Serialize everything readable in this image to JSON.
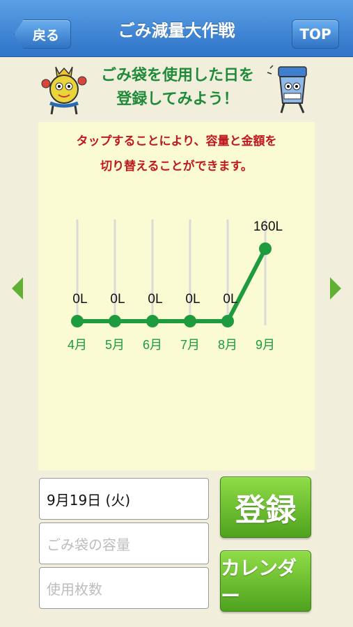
{
  "header": {
    "title": "ごみ減量大作戦",
    "back_label": "戻る",
    "top_label": "TOP"
  },
  "banner": {
    "line1": "ごみ袋を使用した日を",
    "line2": "登録してみよう！"
  },
  "instruction": {
    "line1": "タップすることにより、容量と金額を",
    "line2": "切り替えることができます。"
  },
  "chart_data": {
    "type": "line",
    "categories": [
      "4月",
      "5月",
      "6月",
      "7月",
      "8月",
      "9月"
    ],
    "values": [
      0,
      0,
      0,
      0,
      0,
      160
    ],
    "value_labels": [
      "0L",
      "0L",
      "0L",
      "0L",
      "0L",
      "160L"
    ],
    "unit": "L",
    "color": "#1e9a3f"
  },
  "form": {
    "date_value": "9月19日 (火)",
    "capacity_placeholder": "ごみ袋の容量",
    "count_placeholder": "使用枚数"
  },
  "buttons": {
    "register_label": "登録",
    "calendar_label": "カレンダー"
  },
  "colors": {
    "header_blue": "#2f74c7",
    "accent_green": "#5fb033",
    "instruction_red": "#c0181f",
    "panel_bg": "#fafbd2"
  }
}
